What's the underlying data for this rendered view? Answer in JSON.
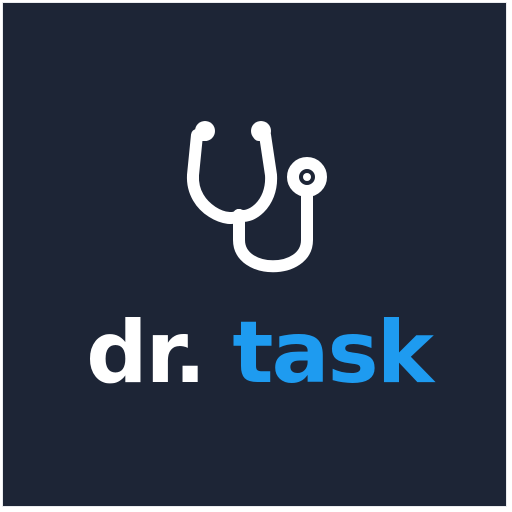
{
  "logo": {
    "icon": "stethoscope-icon",
    "word_primary": "dr.",
    "word_accent": "task"
  },
  "colors": {
    "background": "#1d2536",
    "primary_text": "#ffffff",
    "accent": "#1e9bf0"
  }
}
